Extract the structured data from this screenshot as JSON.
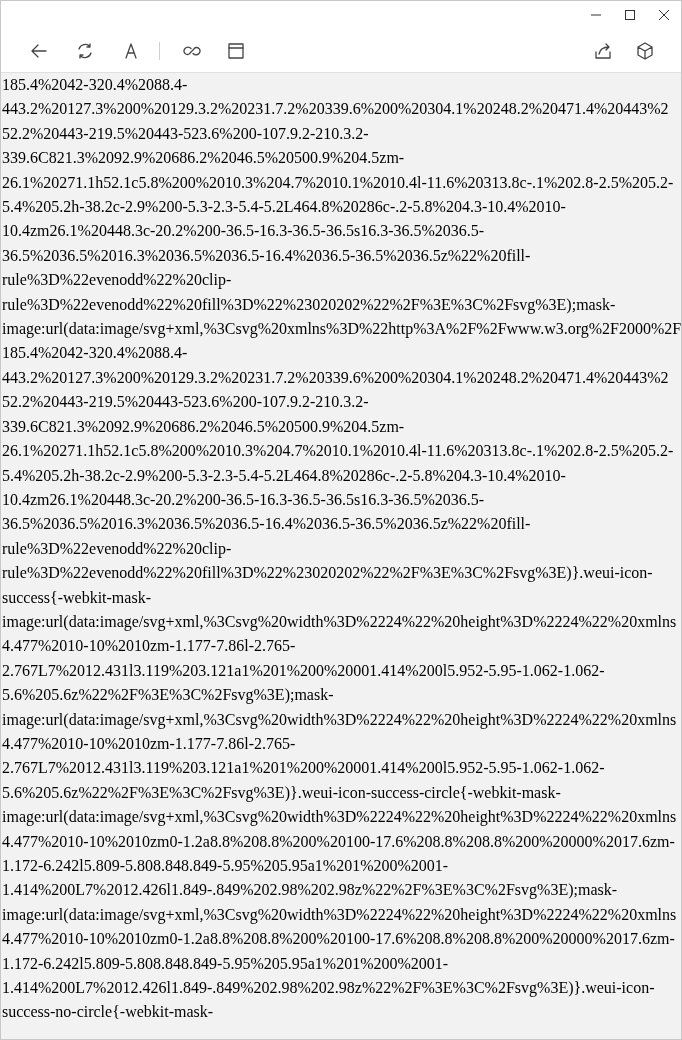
{
  "content": {
    "lines": [
      "185.4%2042-320.4%2088.4-",
      "443.2%20127.3%200%20129.3.2%20231.7.2%20339.6%200%20304.1%20248.2%20471.4%20443%2",
      "52.2%20443-219.5%20443-523.6%200-107.9.2-210.3.2-",
      "339.6C821.3%2092.9%20686.2%2046.5%20500.9%204.5zm-",
      "26.1%20271.1h52.1c5.8%200%2010.3%204.7%2010.1%2010.4l-11.6%20313.8c-.1%202.8-2.5%205.2-",
      "5.4%205.2h-38.2c-2.9%200-5.3-2.3-5.4-5.2L464.8%20286c-.2-5.8%204.3-10.4%2010-",
      "10.4zm26.1%20448.3c-20.2%200-36.5-16.3-36.5-36.5s16.3-36.5%2036.5-",
      "36.5%2036.5%2016.3%2036.5%2036.5-16.4%2036.5-36.5%2036.5z%22%20fill-",
      "rule%3D%22evenodd%22%20clip-",
      "rule%3D%22evenodd%22%20fill%3D%22%23020202%22%2F%3E%3C%2Fsvg%3E);mask-",
      "image:url(data:image/svg+xml,%3Csvg%20xmlns%3D%22http%3A%2F%2Fwww.w3.org%2F2000%2F",
      "185.4%2042-320.4%2088.4-",
      "443.2%20127.3%200%20129.3.2%20231.7.2%20339.6%200%20304.1%20248.2%20471.4%20443%2",
      "52.2%20443-219.5%20443-523.6%200-107.9.2-210.3.2-",
      "339.6C821.3%2092.9%20686.2%2046.5%20500.9%204.5zm-",
      "26.1%20271.1h52.1c5.8%200%2010.3%204.7%2010.1%2010.4l-11.6%20313.8c-.1%202.8-2.5%205.2-",
      "5.4%205.2h-38.2c-2.9%200-5.3-2.3-5.4-5.2L464.8%20286c-.2-5.8%204.3-10.4%2010-",
      "10.4zm26.1%20448.3c-20.2%200-36.5-16.3-36.5-36.5s16.3-36.5%2036.5-",
      "36.5%2036.5%2016.3%2036.5%2036.5-16.4%2036.5-36.5%2036.5z%22%20fill-",
      "rule%3D%22evenodd%22%20clip-",
      "rule%3D%22evenodd%22%20fill%3D%22%23020202%22%2F%3E%3C%2Fsvg%3E)}.weui-icon-",
      "success{-webkit-mask-",
      "image:url(data:image/svg+xml,%3Csvg%20width%3D%2224%22%20height%3D%2224%22%20xmlns",
      "4.477%2010-10%2010zm-1.177-7.86l-2.765-",
      "2.767L7%2012.431l3.119%203.121a1%201%200%20001.414%200l5.952-5.95-1.062-1.062-",
      "5.6%205.6z%22%2F%3E%3C%2Fsvg%3E);mask-",
      "image:url(data:image/svg+xml,%3Csvg%20width%3D%2224%22%20height%3D%2224%22%20xmlns",
      "4.477%2010-10%2010zm-1.177-7.86l-2.765-",
      "2.767L7%2012.431l3.119%203.121a1%201%200%20001.414%200l5.952-5.95-1.062-1.062-",
      "5.6%205.6z%22%2F%3E%3C%2Fsvg%3E)}.weui-icon-success-circle{-webkit-mask-",
      "image:url(data:image/svg+xml,%3Csvg%20width%3D%2224%22%20height%3D%2224%22%20xmlns",
      "4.477%2010-10%2010zm0-1.2a8.8%208.8%200%20100-17.6%208.8%208.8%200%20000%2017.6zm-",
      "1.172-6.242l5.809-5.808.848.849-5.95%205.95a1%201%200%2001-",
      "1.414%200L7%2012.426l1.849-.849%202.98%202.98z%22%2F%3E%3C%2Fsvg%3E);mask-",
      "image:url(data:image/svg+xml,%3Csvg%20width%3D%2224%22%20height%3D%2224%22%20xmlns",
      "4.477%2010-10%2010zm0-1.2a8.8%208.8%200%20100-17.6%208.8%208.8%200%20000%2017.6zm-",
      "1.172-6.242l5.809-5.808.848.849-5.95%205.95a1%201%200%2001-",
      "1.414%200L7%2012.426l1.849-.849%202.98%202.98z%22%2F%3E%3C%2Fsvg%3E)}.weui-icon-",
      "success-no-circle{-webkit-mask-"
    ]
  }
}
